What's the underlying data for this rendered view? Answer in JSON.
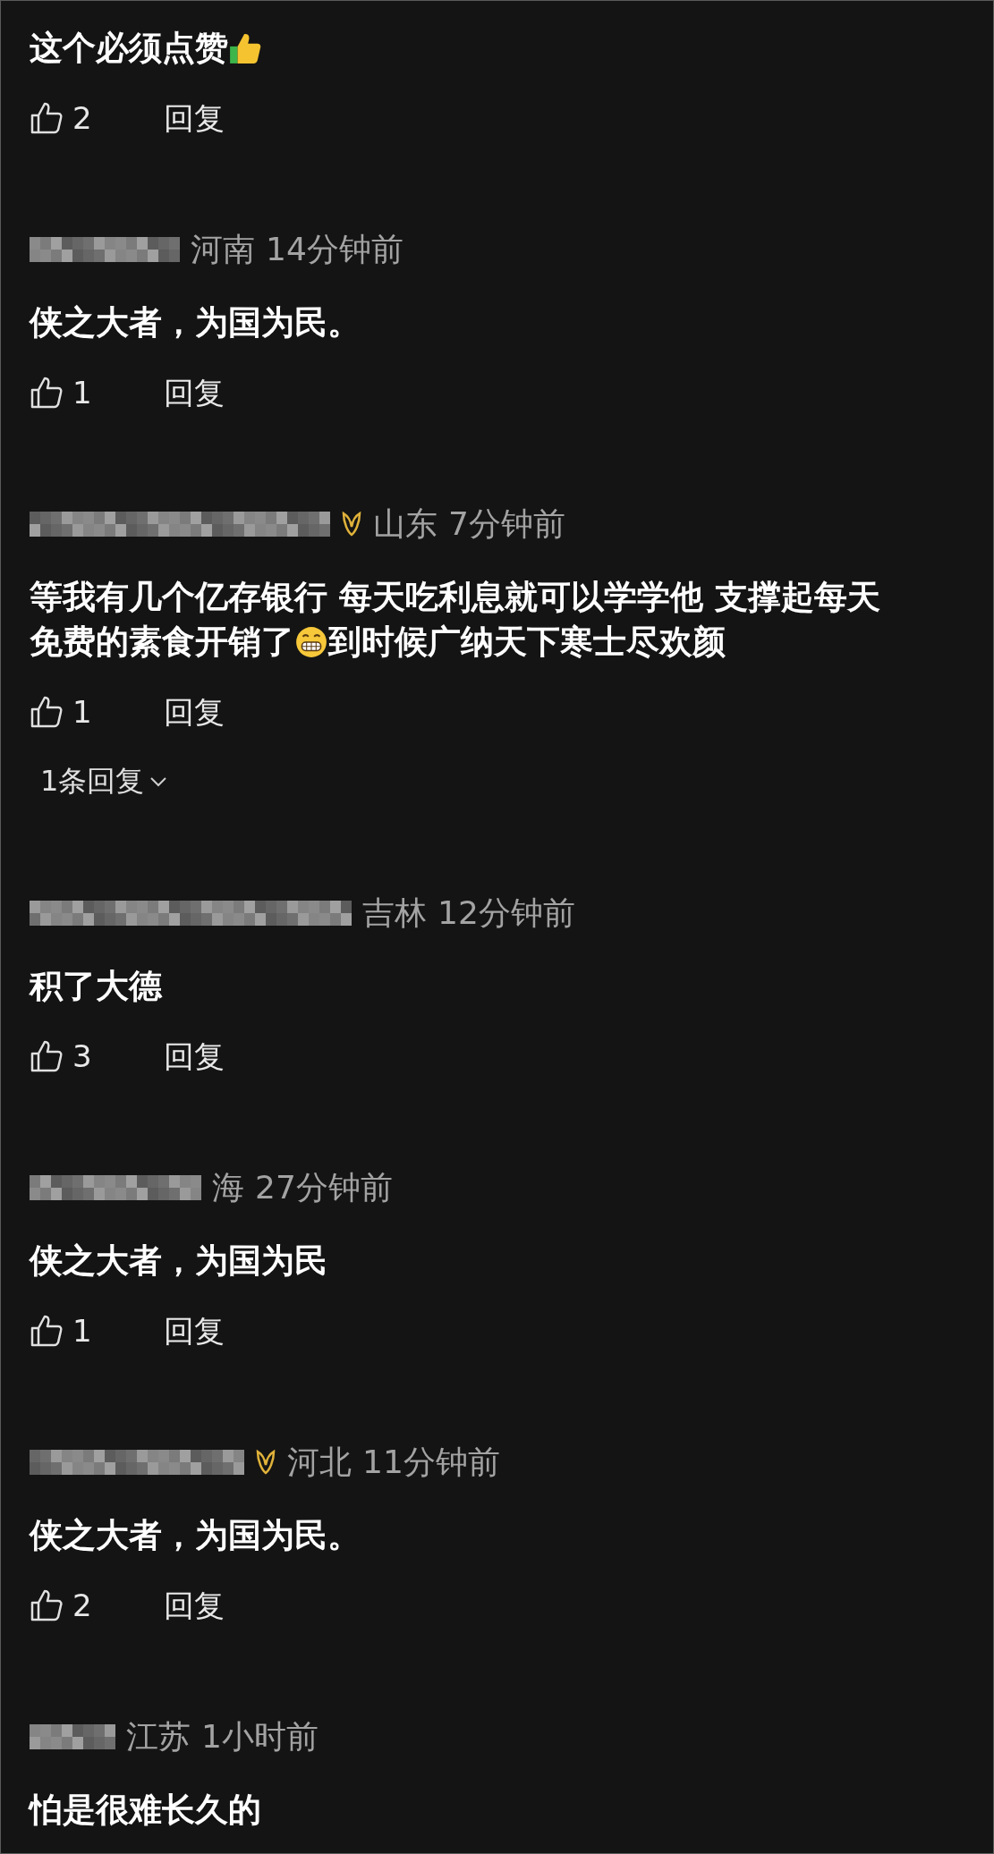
{
  "comments": [
    {
      "lines": [
        [
          {
            "kind": "text",
            "value": "这个必须点赞"
          },
          {
            "kind": "thumbs_up_emoji"
          }
        ]
      ],
      "likes": "2",
      "reply": "回复"
    },
    {
      "badge": false,
      "location": "河南",
      "time": "14分钟前",
      "lines": [
        [
          {
            "kind": "text",
            "value": "侠之大者，为国为民。"
          }
        ]
      ],
      "likes": "1",
      "reply": "回复"
    },
    {
      "badge": true,
      "location": "山东",
      "time": "7分钟前",
      "lines": [
        [
          {
            "kind": "text",
            "value": "等我有几个亿存银行 每天吃利息就可以学学他 支撑起每天"
          }
        ],
        [
          {
            "kind": "text",
            "value": "免费的素食开销了"
          },
          {
            "kind": "grin_emoji"
          },
          {
            "kind": "text",
            "value": "到时候广纳天下寒士尽欢颜"
          }
        ]
      ],
      "likes": "1",
      "reply": "回复",
      "replies_link": "1条回复"
    },
    {
      "badge": false,
      "location": "吉林",
      "time": "12分钟前",
      "lines": [
        [
          {
            "kind": "text",
            "value": "积了大德"
          }
        ]
      ],
      "likes": "3",
      "reply": "回复"
    },
    {
      "badge": false,
      "location": "海",
      "time": "27分钟前",
      "lines": [
        [
          {
            "kind": "text",
            "value": "侠之大者，为国为民"
          }
        ]
      ],
      "likes": "1",
      "reply": "回复"
    },
    {
      "badge": true,
      "location": "河北",
      "time": "11分钟前",
      "lines": [
        [
          {
            "kind": "text",
            "value": "侠之大者，为国为民。"
          }
        ]
      ],
      "likes": "2",
      "reply": "回复"
    },
    {
      "badge": false,
      "location": "江苏",
      "time": "1小时前",
      "lines": [
        [
          {
            "kind": "text",
            "value": "怕是很难长久的"
          }
        ]
      ]
    }
  ]
}
